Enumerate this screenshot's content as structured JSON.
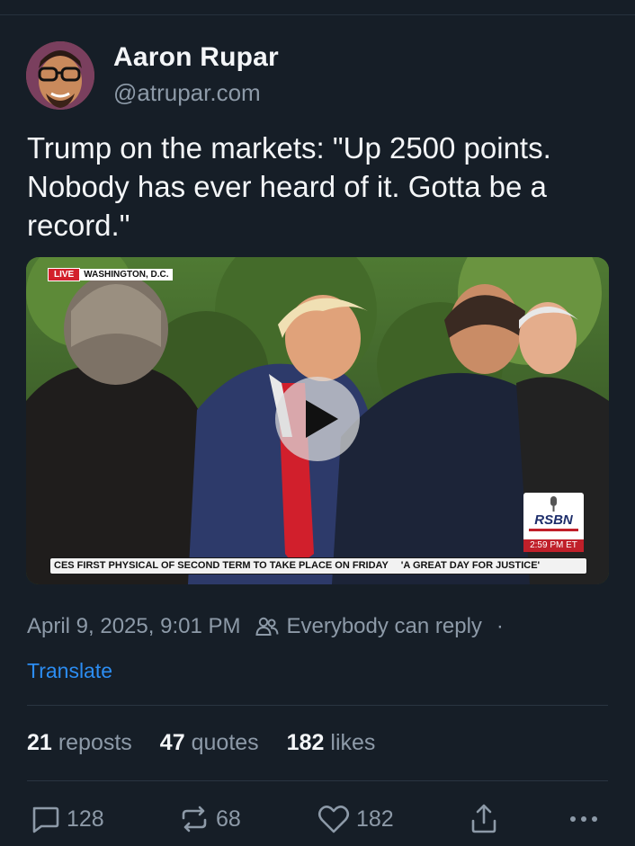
{
  "author": {
    "display_name": "Aaron Rupar",
    "handle": "@atrupar.com",
    "avatar_icon": "avatar-photo"
  },
  "post": {
    "text": "Trump on the markets: \"Up 2500 points. Nobody has ever heard of it. Gotta be a record.\""
  },
  "video": {
    "live_label": "LIVE",
    "location_label": "WASHINGTON, D.C.",
    "network_logo": "RSBN",
    "broadcast_time": "2:59 PM ET",
    "ticker_left": "CES FIRST PHYSICAL OF SECOND TERM TO TAKE PLACE ON FRIDAY",
    "ticker_right": "'A GREAT DAY FOR JUSTICE'",
    "play_icon": "play-icon"
  },
  "meta": {
    "timestamp": "April 9, 2025, 9:01 PM",
    "reply_setting": "Everybody can reply",
    "separator": "·",
    "translate_label": "Translate"
  },
  "stats": {
    "reposts_count": "21",
    "reposts_label": "reposts",
    "quotes_count": "47",
    "quotes_label": "quotes",
    "likes_count": "182",
    "likes_label": "likes"
  },
  "actions": {
    "reply_count": "128",
    "repost_count": "68",
    "like_count": "182"
  },
  "colors": {
    "background": "#161e27",
    "primary_text": "#f4f6f8",
    "secondary_text": "#8d9aa8",
    "link": "#2c8df2",
    "live_red": "#d3202b"
  }
}
